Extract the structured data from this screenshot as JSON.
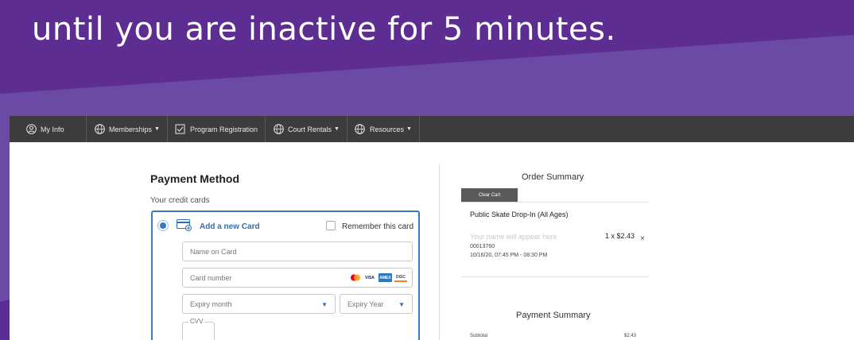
{
  "banner": {
    "headline": "until you are inactive for 5 minutes."
  },
  "colors": {
    "banner_purple": "#5b2b8c",
    "nav_bg": "#3c3c3c",
    "accent_blue": "#3a79c0",
    "clear_cart_bg": "#5a5a5a"
  },
  "navbar": {
    "items": [
      {
        "label": "My Info",
        "icon": "person-icon",
        "dropdown": false
      },
      {
        "label": "Memberships",
        "icon": "globe-icon",
        "dropdown": true
      },
      {
        "label": "Program Registration",
        "icon": "checklist-icon",
        "dropdown": false
      },
      {
        "label": "Court Rentals",
        "icon": "globe-icon",
        "dropdown": true
      },
      {
        "label": "Resources",
        "icon": "globe-icon",
        "dropdown": true
      }
    ]
  },
  "payment_method": {
    "title": "Payment Method",
    "subtitle": "Your credit cards",
    "add_card_label": "Add a new Card",
    "remember_label": "Remember this card",
    "name_placeholder": "Name on Card",
    "card_number_placeholder": "Card number",
    "expiry_month_placeholder": "Expiry month",
    "expiry_year_placeholder": "Expiry Year",
    "cvv_label": "CVV",
    "card_logos": [
      "mastercard",
      "VISA",
      "AMEX",
      "DISC"
    ]
  },
  "order_summary": {
    "title": "Order Summary",
    "clear_cart_label": "Clear Cart",
    "item": {
      "name": "Public Skate Drop-In (All Ages)",
      "name_placeholder": "Your name will appear here",
      "quantity_price": "1 x $2.43",
      "remove_symbol": "×",
      "code": "00013760",
      "datetime": "10/16/20, 07:45 PM - 08:30 PM"
    }
  },
  "payment_summary": {
    "title": "Payment Summary",
    "subtotal_label": "Subtotal",
    "subtotal_value": "$2.43"
  }
}
